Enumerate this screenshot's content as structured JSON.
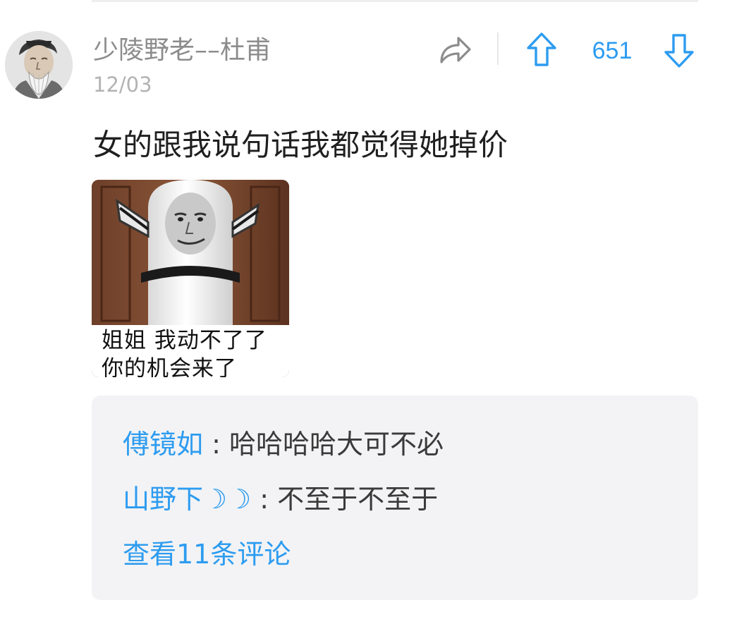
{
  "post": {
    "author": "少陵野老––杜甫",
    "date": "12/03",
    "text": "女的跟我说句话我都觉得她掉价",
    "vote_count": "651",
    "icons": {
      "share": "share-icon",
      "upvote": "arrow-up-icon",
      "downvote": "arrow-down-icon",
      "avatar": "avatar-portrait"
    },
    "accent_color": "#2d9cf0",
    "image": {
      "caption_line1": "姐姐  我动不了了",
      "caption_line2": "你的机会来了"
    }
  },
  "comments": {
    "items": [
      {
        "author": "傅镜如",
        "separator": " : ",
        "text": "哈哈哈哈大可不必"
      },
      {
        "author": "山野下☽☽",
        "separator": " : ",
        "text": "不至于不至于"
      }
    ],
    "view_more": "查看11条评论"
  }
}
